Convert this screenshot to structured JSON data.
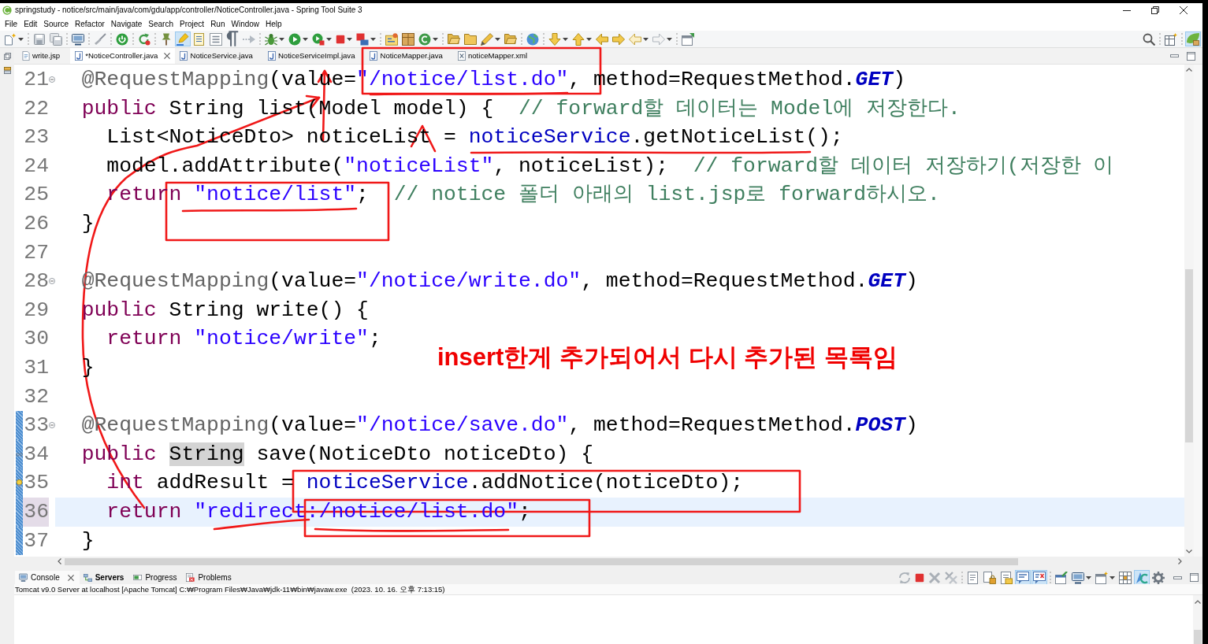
{
  "window": {
    "title": "springstudy - notice/src/main/java/com/gdu/app/controller/NoticeController.java - Spring Tool Suite 3"
  },
  "menu": [
    "File",
    "Edit",
    "Source",
    "Refactor",
    "Navigate",
    "Search",
    "Project",
    "Run",
    "Window",
    "Help"
  ],
  "toolbar": {
    "groups": [
      [
        {
          "dropdown": true,
          "pressed": false
        }
      ],
      [
        {
          "dropdown": false,
          "pressed": false
        },
        {
          "dropdown": false,
          "pressed": false
        }
      ],
      [
        {
          "dropdown": false,
          "pressed": false
        }
      ],
      [
        {
          "dropdown": false,
          "pressed": false
        }
      ],
      [
        {
          "dropdown": false,
          "pressed": false
        }
      ],
      [
        {
          "dropdown": false,
          "pressed": false
        }
      ],
      [
        {
          "dropdown": false,
          "pressed": false
        },
        {
          "dropdown": false,
          "pressed": true
        },
        {
          "dropdown": false,
          "pressed": false
        },
        {
          "dropdown": false,
          "pressed": false
        },
        {
          "dropdown": false,
          "pressed": false
        },
        {
          "dropdown": false,
          "pressed": false
        }
      ],
      [
        {
          "dropdown": true,
          "pressed": false
        },
        {
          "dropdown": true,
          "pressed": false
        },
        {
          "dropdown": true,
          "pressed": false
        },
        {
          "dropdown": true,
          "pressed": false
        },
        {
          "dropdown": true,
          "pressed": false
        }
      ],
      [
        {
          "dropdown": false,
          "pressed": false
        },
        {
          "dropdown": false,
          "pressed": false
        },
        {
          "dropdown": true,
          "pressed": false
        }
      ],
      [
        {
          "dropdown": false,
          "pressed": false
        },
        {
          "dropdown": false,
          "pressed": false
        },
        {
          "dropdown": true,
          "pressed": false
        },
        {
          "dropdown": false,
          "pressed": false
        }
      ],
      [
        {
          "dropdown": false,
          "pressed": false
        }
      ],
      [
        {
          "dropdown": true,
          "pressed": false
        },
        {
          "dropdown": true,
          "pressed": false
        },
        {
          "dropdown": false,
          "pressed": false
        },
        {
          "dropdown": false,
          "pressed": false
        },
        {
          "dropdown": true,
          "pressed": false
        },
        {
          "dropdown": true,
          "pressed": false
        }
      ],
      [
        {
          "dropdown": false,
          "pressed": false
        }
      ]
    ]
  },
  "toolbar_right": {
    "groups": [
      [
        {
          "dropdown": false,
          "pressed": false
        }
      ],
      [
        {
          "dropdown": false,
          "pressed": false
        }
      ],
      [
        {
          "dropdown": false,
          "pressed": true
        }
      ]
    ]
  },
  "editor_tabs": [
    {
      "label": "write.jsp",
      "kind": "jsp",
      "selected": false
    },
    {
      "label": "*NoticeController.java",
      "kind": "java",
      "selected": true
    },
    {
      "label": "NoticeService.java",
      "kind": "java",
      "selected": false
    },
    {
      "label": "NoticeServiceImpl.java",
      "kind": "java",
      "selected": false
    },
    {
      "label": "NoticeMapper.java",
      "kind": "java",
      "selected": false
    },
    {
      "label": "noticeMapper.xml",
      "kind": "xml",
      "selected": false
    }
  ],
  "editor": {
    "lines": [
      {
        "number": "21",
        "kind": "plain",
        "foldable": true,
        "changed": false,
        "current": false,
        "tokens": [
          {
            "kind": "annotation",
            "text": "\t@RequestMapping"
          },
          {
            "kind": "plain",
            "text": "(value="
          },
          {
            "kind": "string",
            "text": "\"/notice/list.do\""
          },
          {
            "kind": "plain",
            "text": ", method=RequestMethod."
          },
          {
            "kind": "constant",
            "text": "GET"
          },
          {
            "kind": "plain",
            "text": ")"
          }
        ]
      },
      {
        "number": "22",
        "kind": "plain",
        "foldable": false,
        "changed": false,
        "current": false,
        "tokens": [
          {
            "kind": "keyword",
            "text": "\tpublic"
          },
          {
            "kind": "plain",
            "text": " String list(Model model) {  "
          },
          {
            "kind": "comment",
            "text": "// forward할 데이터는 Model에 저장한다."
          }
        ]
      },
      {
        "number": "23",
        "kind": "plain",
        "foldable": false,
        "changed": false,
        "current": false,
        "tokens": [
          {
            "kind": "plain",
            "text": "\t\tList<NoticeDto> noticeList = "
          },
          {
            "kind": "field",
            "text": "noticeService"
          },
          {
            "kind": "plain",
            "text": ".getNoticeList();"
          }
        ]
      },
      {
        "number": "24",
        "kind": "plain",
        "foldable": false,
        "changed": false,
        "current": false,
        "tokens": [
          {
            "kind": "plain",
            "text": "\t\tmodel.addAttribute("
          },
          {
            "kind": "string",
            "text": "\"noticeList\""
          },
          {
            "kind": "plain",
            "text": ", noticeList);  "
          },
          {
            "kind": "comment",
            "text": "// forward할 데이터 저장하기(저장한 이"
          }
        ]
      },
      {
        "number": "25",
        "kind": "plain",
        "foldable": false,
        "changed": false,
        "current": false,
        "tokens": [
          {
            "kind": "keyword",
            "text": "\t\treturn "
          },
          {
            "kind": "string",
            "text": "\"notice/list\""
          },
          {
            "kind": "plain",
            "text": ";  "
          },
          {
            "kind": "comment",
            "text": "// notice 폴더 아래의 list.jsp로 forward하시오."
          }
        ]
      },
      {
        "number": "26",
        "kind": "plain",
        "foldable": false,
        "changed": false,
        "current": false,
        "tokens": [
          {
            "kind": "plain",
            "text": "\t}"
          }
        ]
      },
      {
        "number": "27",
        "kind": "plain",
        "foldable": false,
        "changed": false,
        "current": false
      },
      {
        "number": "28",
        "kind": "plain",
        "foldable": true,
        "changed": false,
        "current": false,
        "tokens": [
          {
            "kind": "annotation",
            "text": "\t@RequestMapping"
          },
          {
            "kind": "plain",
            "text": "(value="
          },
          {
            "kind": "string",
            "text": "\"/notice/write.do\""
          },
          {
            "kind": "plain",
            "text": ", method=RequestMethod."
          },
          {
            "kind": "constant",
            "text": "GET"
          },
          {
            "kind": "plain",
            "text": ")"
          }
        ]
      },
      {
        "number": "29",
        "kind": "plain",
        "foldable": false,
        "changed": false,
        "current": false,
        "tokens": [
          {
            "kind": "keyword",
            "text": "\tpublic"
          },
          {
            "kind": "plain",
            "text": " String write() {"
          }
        ]
      },
      {
        "number": "30",
        "kind": "plain",
        "foldable": false,
        "changed": false,
        "current": false,
        "tokens": [
          {
            "kind": "keyword",
            "text": "\t\treturn "
          },
          {
            "kind": "string",
            "text": "\"notice/write\""
          },
          {
            "kind": "plain",
            "text": ";"
          }
        ]
      },
      {
        "number": "31",
        "kind": "plain",
        "foldable": false,
        "changed": false,
        "current": false,
        "tokens": [
          {
            "kind": "plain",
            "text": "\t}"
          }
        ]
      },
      {
        "number": "32",
        "kind": "plain",
        "foldable": false,
        "changed": false,
        "current": false
      },
      {
        "number": "33",
        "kind": "plain",
        "foldable": true,
        "changed": true,
        "current": false,
        "tokens": [
          {
            "kind": "annotation",
            "text": "\t@RequestMapping"
          },
          {
            "kind": "plain",
            "text": "(value="
          },
          {
            "kind": "string",
            "text": "\"/notice/save.do\""
          },
          {
            "kind": "plain",
            "text": ", method=RequestMethod."
          },
          {
            "kind": "constant",
            "text": "POST"
          },
          {
            "kind": "plain",
            "text": ")"
          }
        ]
      },
      {
        "number": "34",
        "kind": "override",
        "foldable": false,
        "changed": true,
        "current": false,
        "tokens": [
          {
            "kind": "keyword",
            "text": "\tpublic "
          },
          {
            "kind": "occurrence",
            "text": "String"
          },
          {
            "kind": "plain",
            "text": " save(NoticeDto noticeDto) {"
          }
        ]
      },
      {
        "number": "35",
        "kind": "quick-fix",
        "foldable": false,
        "changed": true,
        "current": false,
        "tokens": [
          {
            "kind": "keyword",
            "text": "\t\tint"
          },
          {
            "kind": "plain",
            "text": " addResult = "
          },
          {
            "kind": "field",
            "text": "noticeService"
          },
          {
            "kind": "plain",
            "text": ".addNotice(noticeDto);"
          }
        ]
      },
      {
        "number": "36",
        "kind": "plain",
        "foldable": false,
        "changed": true,
        "current": true,
        "tokens": [
          {
            "kind": "keyword",
            "text": "\t\treturn "
          },
          {
            "kind": "string",
            "text": "\"redirect:/notice/list.do\""
          },
          {
            "kind": "plain",
            "text": ";"
          }
        ]
      },
      {
        "number": "37",
        "kind": "plain",
        "foldable": false,
        "changed": true,
        "current": false,
        "tokens": [
          {
            "kind": "plain",
            "text": "\t}"
          }
        ]
      }
    ]
  },
  "overlay_note": "insert한게 추가되어서 다시 추가된 목록임",
  "bottom_panel": {
    "tabs": [
      {
        "label": "Console",
        "selected": true,
        "changed": false
      },
      {
        "label": "Servers",
        "selected": false,
        "changed": true
      },
      {
        "label": "Progress",
        "selected": false,
        "changed": false
      },
      {
        "label": "Problems",
        "selected": false,
        "changed": false
      }
    ],
    "toolbar": {
      "groups": [
        [
          {
            "dropdown": false,
            "pressed": false
          },
          {
            "dropdown": false,
            "pressed": false
          },
          {
            "dropdown": false,
            "pressed": false
          },
          {
            "dropdown": false,
            "pressed": false
          }
        ],
        [
          {
            "dropdown": false,
            "pressed": false
          },
          {
            "dropdown": false,
            "pressed": false
          },
          {
            "dropdown": false,
            "pressed": false
          },
          {
            "dropdown": false,
            "pressed": true
          },
          {
            "dropdown": false,
            "pressed": true
          }
        ],
        [
          {
            "dropdown": false,
            "pressed": false
          },
          {
            "dropdown": true,
            "pressed": false
          },
          {
            "dropdown": true,
            "pressed": false
          },
          {
            "dropdown": false,
            "pressed": false
          },
          {
            "dropdown": false,
            "pressed": true
          },
          {
            "dropdown": false,
            "pressed": false
          }
        ]
      ]
    },
    "console_header": "Tomcat v9.0 Server at localhost [Apache Tomcat] C:₩Program Files₩Java₩jdk-11₩bin₩javaw.exe  (2023. 10. 16. 오후 7:13:15)"
  }
}
